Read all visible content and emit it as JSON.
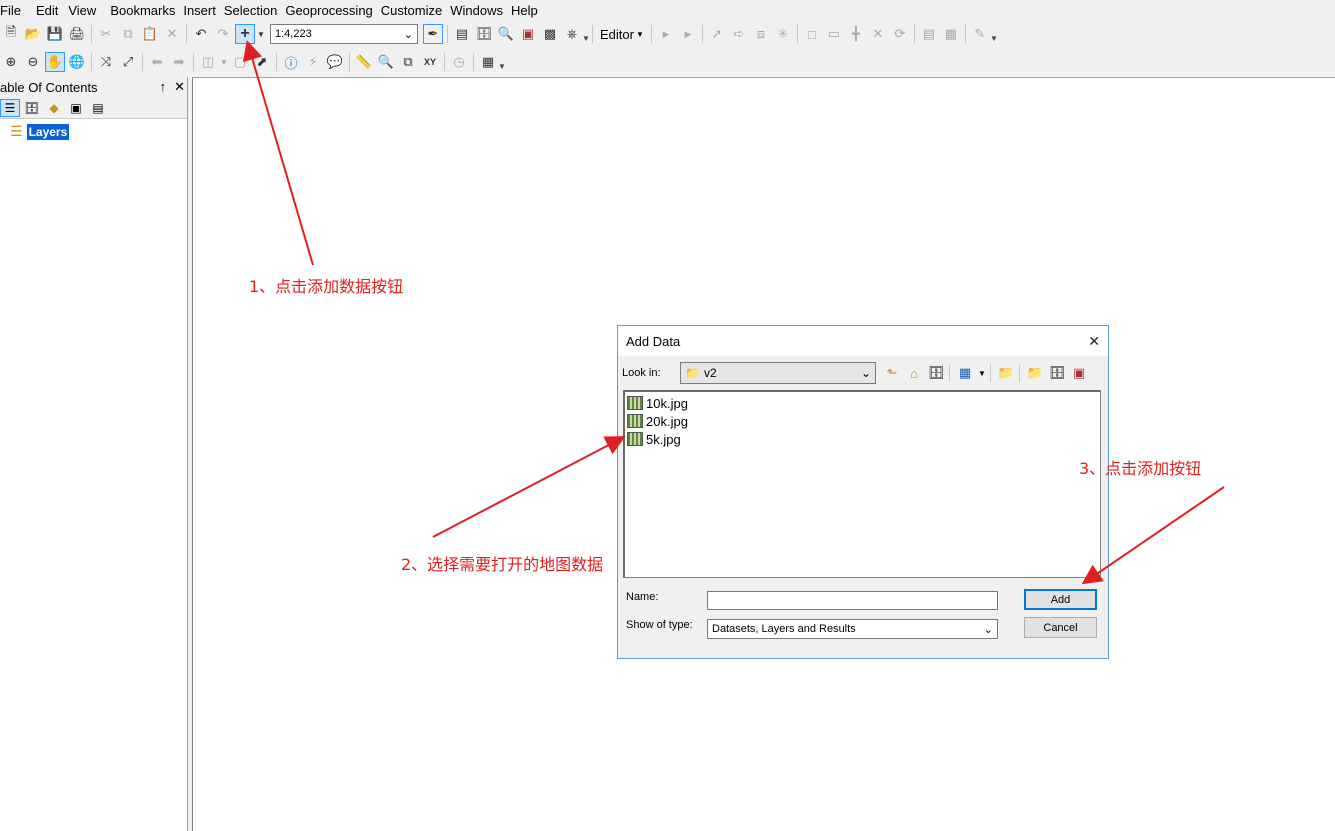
{
  "menu": [
    "File",
    "Edit",
    "View",
    "Bookmarks",
    "Insert",
    "Selection",
    "Geoprocessing",
    "Customize",
    "Windows",
    "Help"
  ],
  "toolbar": {
    "scale_value": "1:4,223",
    "editor_label": "Editor"
  },
  "toc": {
    "title": "able Of Contents",
    "pin": "↑",
    "close": "✕",
    "root_layer": "Layers"
  },
  "dialog": {
    "title": "Add Data",
    "close": "✕",
    "look_in_label": "Look in:",
    "look_in_value": "v2",
    "files": [
      "10k.jpg",
      "20k.jpg",
      "5k.jpg"
    ],
    "name_label": "Name:",
    "name_value": "",
    "show_type_label": "Show of type:",
    "show_type_value": "Datasets, Layers and Results",
    "add_label": "Add",
    "cancel_label": "Cancel"
  },
  "annotations": {
    "step1": "1、点击添加数据按钮",
    "step2": "2、选择需要打开的地图数据",
    "step3": "3、点击添加按钮"
  },
  "colors": {
    "annotation_red": "#e02020",
    "selection_blue": "#0a64d4",
    "dialog_border": "#5b9bd5"
  }
}
